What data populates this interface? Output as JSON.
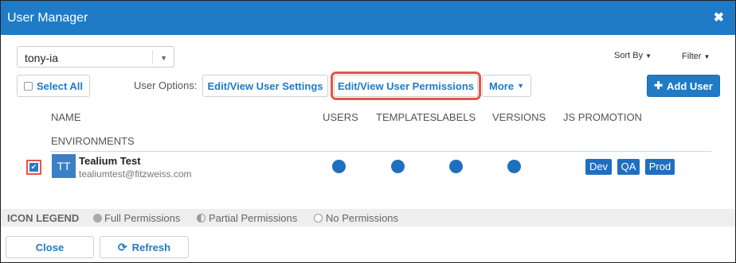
{
  "window": {
    "title": "User Manager",
    "close_glyph": "✖"
  },
  "account_select": {
    "value": "tony-ia",
    "arrow": "▼"
  },
  "toolbar": {
    "sort_by": "Sort By",
    "filter": "Filter",
    "caret": "▼",
    "select_all": "Select All",
    "user_options_label": "User Options:",
    "edit_settings": "Edit/View User Settings",
    "edit_permissions": "Edit/View User Permissions",
    "more": "More",
    "add_user": "Add User",
    "add_icon": "✚"
  },
  "columns": {
    "name": "NAME",
    "users": "USERS",
    "templates": "TEMPLATES",
    "labels": "LABELS",
    "versions": "VERSIONS",
    "js_promotion": "JS PROMOTION",
    "environments": "ENVIRONMENTS"
  },
  "user": {
    "initials": "TT",
    "name": "Tealium Test",
    "email": "tealiumtest@fitzweiss.com",
    "checked_glyph": "✔",
    "environments": [
      "Dev",
      "QA",
      "Prod"
    ]
  },
  "legend": {
    "title": "ICON LEGEND",
    "full": "Full Permissions",
    "partial": "Partial Permissions",
    "none": "No Permissions"
  },
  "footer": {
    "close": "Close",
    "refresh": "Refresh",
    "refresh_icon": "⟳"
  },
  "colors": {
    "accent": "#1f7bc6",
    "highlight": "#e8534a",
    "dot": "#1f6fc0"
  }
}
